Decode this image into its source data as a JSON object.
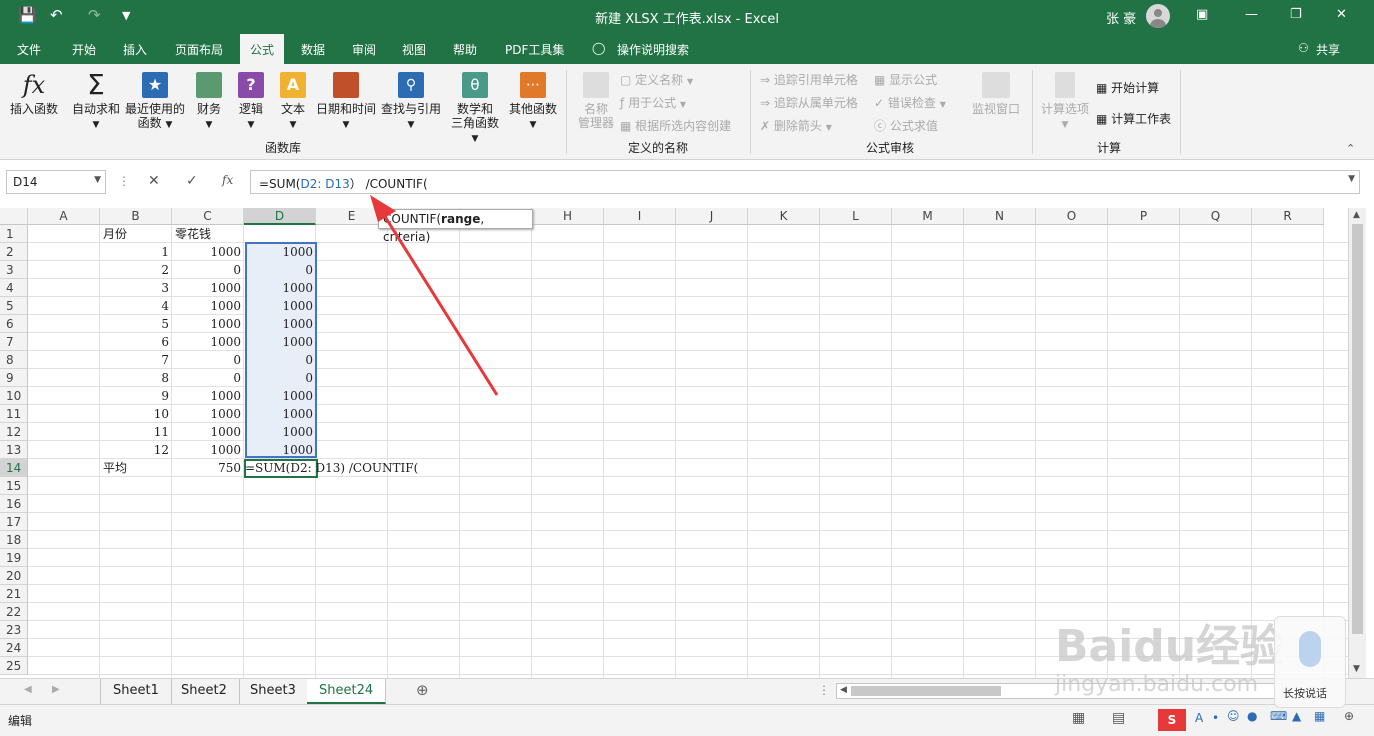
{
  "titlebar": {
    "title": "新建 XLSX 工作表.xlsx  -  Excel",
    "user": "张 豪"
  },
  "tabs": [
    "文件",
    "开始",
    "插入",
    "页面布局",
    "公式",
    "数据",
    "审阅",
    "视图",
    "帮助",
    "PDF工具集"
  ],
  "tell_me": "操作说明搜索",
  "share": "共享",
  "ribbon": {
    "insert_function": "插入函数",
    "autosum": "自动求和",
    "recent_line1": "最近使用的",
    "recent_line2": "函数",
    "finance": "财务",
    "logic": "逻辑",
    "text": "文本",
    "datetime": "日期和时间",
    "lookup": "查找与引用",
    "math_line1": "数学和",
    "math_line2": "三角函数",
    "other": "其他函数",
    "group_library": "函数库",
    "name_mgr_line1": "名称",
    "name_mgr_line2": "管理器",
    "define_name": "定义名称",
    "use_in_formula": "用于公式",
    "create_from_sel": "根据所选内容创建",
    "group_names": "定义的名称",
    "trace_precedents": "追踪引用单元格",
    "trace_dependents": "追踪从属单元格",
    "remove_arrows": "删除箭头",
    "show_formulas": "显示公式",
    "error_check": "错误检查",
    "evaluate": "公式求值",
    "watch": "监视窗口",
    "group_audit": "公式审核",
    "calc_options": "计算选项",
    "calc_now": "开始计算",
    "calc_sheet": "计算工作表",
    "group_calc": "计算"
  },
  "formula_bar": {
    "name_box": "D14",
    "fx": "fx",
    "formula_prefix": "=SUM(",
    "formula_ref": "D2: D13",
    "formula_suffix": "） /COUNTIF("
  },
  "tooltip": {
    "fn": "COUNTIF(",
    "arg1": "range",
    "rest": ", criteria)"
  },
  "columns": [
    "A",
    "B",
    "C",
    "D",
    "E",
    "F",
    "G",
    "H",
    "I",
    "J",
    "K",
    "L",
    "M",
    "N",
    "O",
    "P",
    "Q",
    "R"
  ],
  "rows": [
    "1",
    "2",
    "3",
    "4",
    "5",
    "6",
    "7",
    "8",
    "9",
    "10",
    "11",
    "12",
    "13",
    "14",
    "15",
    "16",
    "17",
    "18",
    "19",
    "20",
    "21",
    "22",
    "23",
    "24",
    "25"
  ],
  "cells": {
    "header_b": "月份",
    "header_c": "零花钱",
    "b": [
      "1",
      "2",
      "3",
      "4",
      "5",
      "6",
      "7",
      "8",
      "9",
      "10",
      "11",
      "12"
    ],
    "c": [
      "1000",
      "0",
      "1000",
      "1000",
      "1000",
      "1000",
      "0",
      "0",
      "1000",
      "1000",
      "1000",
      "1000"
    ],
    "d": [
      "1000",
      "0",
      "1000",
      "1000",
      "1000",
      "1000",
      "0",
      "0",
      "1000",
      "1000",
      "1000",
      "1000"
    ],
    "avg_label": "平均",
    "avg_value": "750",
    "d14": "=SUM(D2: D13) /COUNTIF("
  },
  "sheets": [
    "Sheet1",
    "Sheet2",
    "Sheet3",
    "Sheet24"
  ],
  "active_sheet": "Sheet24",
  "status": {
    "mode": "编辑"
  },
  "watermark": {
    "brand": "Baidu经验",
    "url": "jingyan.baidu.com",
    "voice": "长按说话"
  },
  "colors": {
    "excel_green": "#217346",
    "selection_blue": "#4472c4",
    "arrow_red": "#e8393a"
  }
}
